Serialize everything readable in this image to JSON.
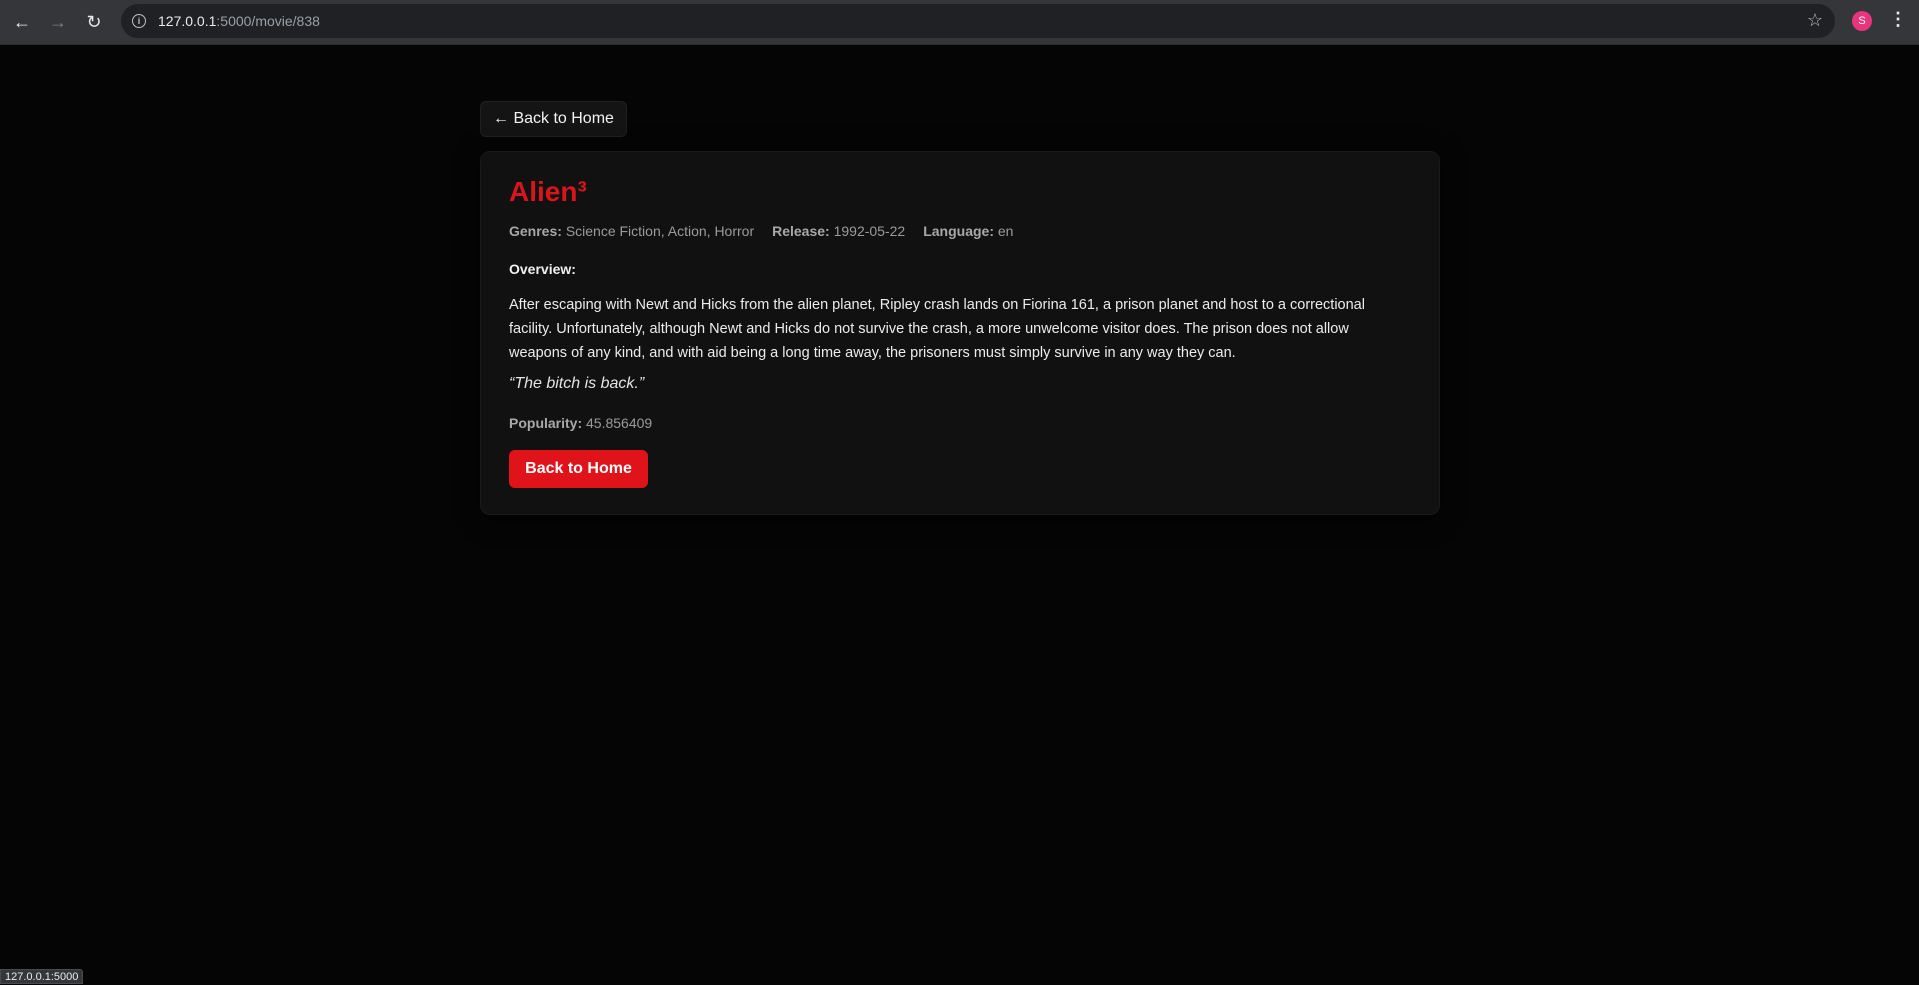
{
  "browser": {
    "url_host": "127.0.0.1",
    "url_rest": ":5000/movie/838",
    "avatar_letter": "S",
    "status_text": "127.0.0.1:5000"
  },
  "nav": {
    "back_link": "← Back to Home"
  },
  "movie": {
    "title": "Alien³",
    "genres_label": "Genres:",
    "genres": "Science Fiction, Action, Horror",
    "release_label": "Release:",
    "release": "1992-05-22",
    "language_label": "Language:",
    "language": "en",
    "overview_label": "Overview:",
    "overview": "After escaping with Newt and Hicks from the alien planet, Ripley crash lands on Fiorina 161, a prison planet and host to a correctional facility. Unfortunately, although Newt and Hicks do not survive the crash, a more unwelcome visitor does. The prison does not allow weapons of any kind, and with aid being a long time away, the prisoners must simply survive in any way they can.",
    "tagline": "“The bitch is back.”",
    "popularity_label": "Popularity:",
    "popularity": "45.856409",
    "back_button": "Back to Home"
  },
  "colors": {
    "accent": "#e0131b",
    "title": "#d8141c",
    "background": "#050505",
    "card": "#111111"
  }
}
